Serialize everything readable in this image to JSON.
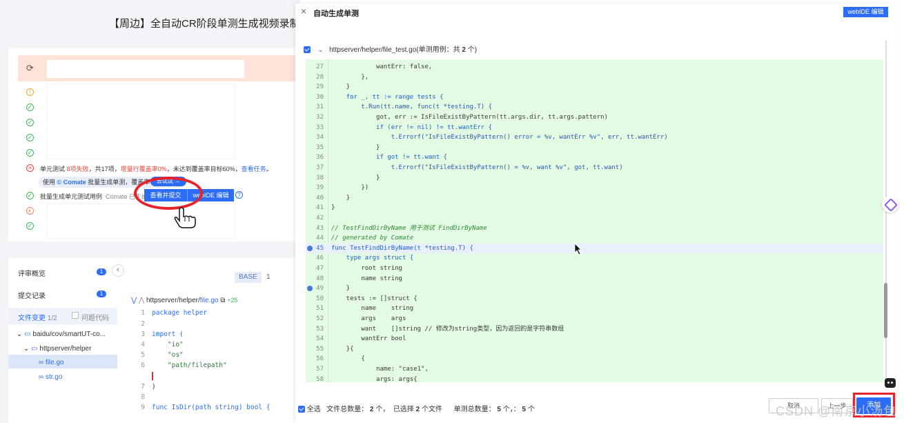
{
  "left_page": {
    "title": "【周边】全自动CR阶段单测生成视频录制，文档",
    "unit_test": {
      "label": "单元测试",
      "failed": "8项失败",
      "total": "共17项",
      "coverage": "增量行覆盖率0%",
      "target": "未达到覆盖率目标60%",
      "view_link": "查看任务"
    },
    "comate_banner": {
      "prefix": "使用",
      "brand": "© Comate",
      "text": "批量生成单测，覆盖率↓",
      "try_button": "去试试 →"
    },
    "batch": {
      "label": "批量生成单元测试用例",
      "status": "Comate 已生成",
      "submit_button": "查看并提交",
      "webide_button": "webIDE 编辑"
    },
    "sidebar": {
      "items": [
        {
          "label": "评审概览",
          "badge": "1"
        },
        {
          "label": "提交记录",
          "badge": "1"
        }
      ],
      "file_change": {
        "label": "文件变更",
        "count": "1/2",
        "filter": "问题代码"
      },
      "tree": [
        {
          "label": "baidu/cov/smartUT-co..."
        },
        {
          "label": "httpserver/helper"
        },
        {
          "label": "file.go"
        },
        {
          "label": "str.go"
        }
      ]
    },
    "diff": {
      "base_tag": "BASE",
      "base_num": "1",
      "file_dir": "httpserver/helper/",
      "file_name": "file.go",
      "added": "+25",
      "lines": [
        {
          "n": "1",
          "code": "package helper"
        },
        {
          "n": "2",
          "code": ""
        },
        {
          "n": "3",
          "code": "import ("
        },
        {
          "n": "4",
          "code": "    \"io\""
        },
        {
          "n": "5",
          "code": "    \"os\""
        },
        {
          "n": "6",
          "code": "    \"path/filepath\""
        },
        {
          "n": "",
          "code": ""
        },
        {
          "n": "7",
          "code": ")"
        },
        {
          "n": "8",
          "code": ""
        },
        {
          "n": "9",
          "code": "func IsDir(path string) bool {"
        }
      ]
    }
  },
  "modal": {
    "title": "自动生成单测",
    "webide_button": "webIDE 编辑",
    "file_header": {
      "path": "httpserver/helper/file_test.go(单测用例：共",
      "count": "2",
      "suffix": "个)"
    },
    "code_lines": [
      {
        "n": "27",
        "code": "            wantErr: false,"
      },
      {
        "n": "28",
        "code": "        },"
      },
      {
        "n": "29",
        "code": "    }"
      },
      {
        "n": "30",
        "code": "    for _, tt := range tests {"
      },
      {
        "n": "31",
        "code": "        t.Run(tt.name, func(t *testing.T) {"
      },
      {
        "n": "32",
        "code": "            got, err := IsFileExistByPattern(tt.args.dir, tt.args.pattern)"
      },
      {
        "n": "33",
        "code": "            if (err != nil) != tt.wantErr {"
      },
      {
        "n": "34",
        "code": "                t.Errorf(\"IsFileExistByPattern() error = %v, wantErr %v\", err, tt.wantErr)"
      },
      {
        "n": "35",
        "code": "            }"
      },
      {
        "n": "36",
        "code": "            if got != tt.want {"
      },
      {
        "n": "37",
        "code": "                t.Errorf(\"IsFileExistByPattern() = %v, want %v\", got, tt.want)"
      },
      {
        "n": "38",
        "code": "            }"
      },
      {
        "n": "39",
        "code": "        })"
      },
      {
        "n": "40",
        "code": "    }"
      },
      {
        "n": "41",
        "code": "}"
      },
      {
        "n": "42",
        "code": ""
      },
      {
        "n": "43",
        "code": "// TestFindDirByName 用于测试 FindDirByName"
      },
      {
        "n": "44",
        "code": "// generated by Comate"
      },
      {
        "n": "45",
        "code": "func TestFindDirByName(t *testing.T) {"
      },
      {
        "n": "46",
        "code": "    type args struct {"
      },
      {
        "n": "47",
        "code": "        root string"
      },
      {
        "n": "48",
        "code": "        name string"
      },
      {
        "n": "49",
        "code": "    }"
      },
      {
        "n": "50",
        "code": "    tests := []struct {"
      },
      {
        "n": "51",
        "code": "        name    string"
      },
      {
        "n": "52",
        "code": "        args    args"
      },
      {
        "n": "53",
        "code": "        want    []string // 修改为string类型，因为返回的是字符串数组"
      },
      {
        "n": "54",
        "code": "        wantErr bool"
      },
      {
        "n": "55",
        "code": "    }{"
      },
      {
        "n": "56",
        "code": "        {"
      },
      {
        "n": "57",
        "code": "            name: \"case1\","
      },
      {
        "n": "58",
        "code": "            args: args{"
      }
    ],
    "footer": {
      "select_all": "全选",
      "total_files_label": "文件总数量：",
      "total_files": "2",
      "total_files_unit": "个，",
      "selected_label": "已选择",
      "selected": "2",
      "selected_unit": "个文件",
      "total_tests_label": "单测总数量：",
      "total_tests": "5",
      "tests_unit": "个，：",
      "tests2": "5",
      "tests2_unit": "个",
      "cancel_button": "取消",
      "prev_button": "上一步",
      "generate_button": "添加"
    }
  },
  "watermark": "CSDN @南京小汤包",
  "colors": {
    "accent": "#2c6cf6",
    "code_bg": "#e2fbe2",
    "highlight": "#e8222a"
  }
}
